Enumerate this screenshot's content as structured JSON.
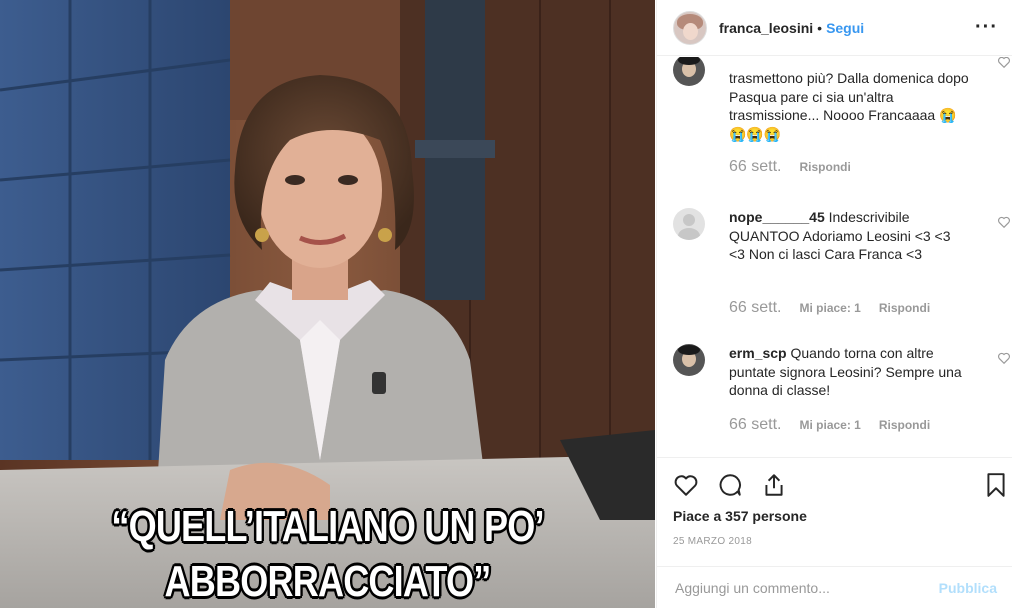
{
  "post": {
    "caption_line1": "“QUELL’ITALIANO UN PO’",
    "caption_line2": "ABBORRACCIATO”"
  },
  "header": {
    "username": "franca_leosini",
    "separator": "•",
    "follow_label": "Segui",
    "more_label": "···"
  },
  "comments": [
    {
      "username": "",
      "text": "trasmettono più? Dalla domenica dopo Pasqua pare ci sia un'altra trasmissione... Noooo Francaaaa 😭😭😭😭",
      "time": "66 sett.",
      "likes": "",
      "reply_label": "Rispondi"
    },
    {
      "username": "nope______45",
      "text": " Indescrivibile QUANTOO Adoriamo Leosini <3 <3 <3 Non ci lasci Cara Franca <3",
      "time": "66 sett.",
      "likes": "Mi piace: 1",
      "reply_label": "Rispondi"
    },
    {
      "username": "erm_scp",
      "text": " Quando torna con altre puntate signora Leosini? Sempre una donna di classe!",
      "time": "66 sett.",
      "likes": "Mi piace: 1",
      "reply_label": "Rispondi"
    }
  ],
  "stats": {
    "likes_text": "Piace a 357 persone",
    "date": "25 MARZO 2018"
  },
  "add_comment": {
    "placeholder": "Aggiungi un commento...",
    "publish_label": "Pubblica"
  },
  "colors": {
    "accent": "#3897f0",
    "publish_disabled": "#b2dffc",
    "meta_grey": "#999999"
  }
}
